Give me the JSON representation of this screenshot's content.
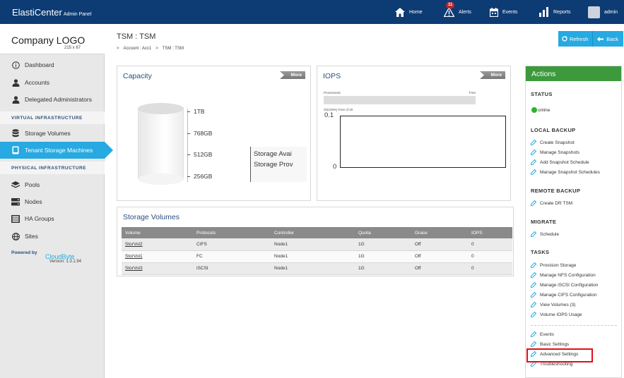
{
  "topbar": {
    "brand": "ElastiCenter",
    "brand_sub": "Admin Panel",
    "nav": {
      "home": "Home",
      "alerts": "Alerts",
      "alerts_count": "11",
      "events": "Events",
      "reports": "Reports",
      "user": "admin"
    }
  },
  "sidebar": {
    "logo": "Company LOGO",
    "logo_size": "215 x 67",
    "items": {
      "dashboard": "Dashboard",
      "accounts": "Accounts",
      "delegated": "Delegated Administrators",
      "storage_volumes": "Storage Volumes",
      "tsm": "Tenant Storage Machines",
      "pools": "Pools",
      "nodes": "Nodes",
      "ha_groups": "HA Groups",
      "sites": "Sites"
    },
    "sections": {
      "virtual": "VIRTUAL INFRASTRUCTURE",
      "physical": "PHYSICAL INFRASTRUCTURE"
    },
    "powered_by": "Powered by",
    "cloudbyte": "CloudByte",
    "version": "Version: 1.3.1.94"
  },
  "header": {
    "title": "TSM : TSM",
    "breadcrumb": [
      "Account : Acc1",
      "TSM : TSM"
    ],
    "refresh": "Refresh",
    "back": "Back"
  },
  "capacity": {
    "title": "Capacity",
    "more": "More",
    "ticks": [
      "1TB",
      "768GB",
      "512GB",
      "256GB"
    ],
    "legend": [
      "Storage Avai",
      "Storage Prov"
    ]
  },
  "iops": {
    "title": "IOPS",
    "more": "More",
    "provisioned": "Provisioned",
    "free": "Free",
    "sub": "20(100%) Free of 20",
    "y_top": "0.1",
    "y_bottom": "0"
  },
  "volumes": {
    "title": "Storage Volumes",
    "columns": [
      "Volume",
      "Protocols",
      "Controller",
      "Quota",
      "Grace",
      "IOPS"
    ],
    "rows": [
      [
        "StorVol2",
        "CIFS",
        "Node1",
        "1G",
        "Off",
        "0"
      ],
      [
        "StorVol1",
        "FC",
        "Node1",
        "1G",
        "Off",
        "0"
      ],
      [
        "StorVol3",
        "iSCSI",
        "Node1",
        "1G",
        "Off",
        "0"
      ]
    ]
  },
  "actions": {
    "title": "Actions",
    "status_h": "STATUS",
    "status": "online",
    "local_backup_h": "LOCAL BACKUP",
    "local_backup": [
      "Create Snapshot",
      "Manage Snapshots",
      "Add Snapshot Schedule",
      "Manage Snapshot Schedules"
    ],
    "remote_backup_h": "REMOTE BACKUP",
    "remote_backup": [
      "Create DR TSM"
    ],
    "migrate_h": "MIGRATE",
    "migrate": [
      "Schedule"
    ],
    "tasks_h": "TASKS",
    "tasks": [
      "Provision Storage",
      "Manage NFS Configuration",
      "Manage iSCSI Configuration",
      "Manage CIFS Configuration",
      "View Volumes (3)",
      "Volume IOPS Usage"
    ],
    "other": [
      "Events",
      "Basic Settings",
      "Advanced Settings",
      "Troubleshooting"
    ]
  }
}
